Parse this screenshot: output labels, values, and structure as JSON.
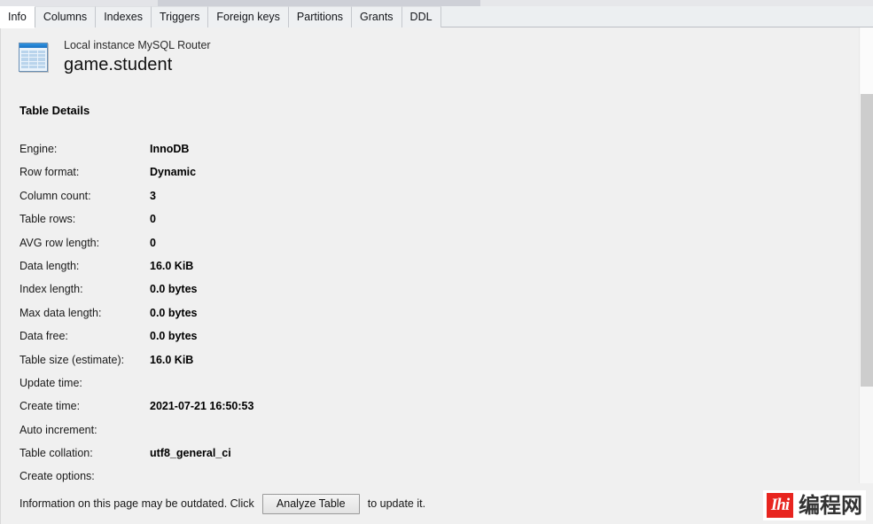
{
  "window": {
    "background_color": "#f0f0f0"
  },
  "tabs": {
    "items": [
      {
        "label": "Info",
        "active": true
      },
      {
        "label": "Columns",
        "active": false
      },
      {
        "label": "Indexes",
        "active": false
      },
      {
        "label": "Triggers",
        "active": false
      },
      {
        "label": "Foreign keys",
        "active": false
      },
      {
        "label": "Partitions",
        "active": false
      },
      {
        "label": "Grants",
        "active": false
      },
      {
        "label": "DDL",
        "active": false
      }
    ]
  },
  "header": {
    "icon": "table-icon",
    "connection": "Local instance MySQL Router",
    "title": "game.student"
  },
  "section": {
    "title": "Table Details"
  },
  "details": {
    "rows": [
      {
        "label": "Engine:",
        "value": "InnoDB"
      },
      {
        "label": "Row format:",
        "value": "Dynamic"
      },
      {
        "label": "Column count:",
        "value": "3"
      },
      {
        "label": "Table rows:",
        "value": "0"
      },
      {
        "label": "AVG row length:",
        "value": "0"
      },
      {
        "label": "Data length:",
        "value": "16.0 KiB"
      },
      {
        "label": "Index length:",
        "value": "0.0 bytes"
      },
      {
        "label": "Max data length:",
        "value": "0.0 bytes"
      },
      {
        "label": "Data free:",
        "value": "0.0 bytes"
      },
      {
        "label": "Table size (estimate):",
        "value": "16.0 KiB"
      },
      {
        "label": "Update time:",
        "value": ""
      },
      {
        "label": "Create time:",
        "value": "2021-07-21 16:50:53"
      },
      {
        "label": "Auto increment:",
        "value": ""
      },
      {
        "label": "Table collation:",
        "value": "utf8_general_ci"
      },
      {
        "label": "Create options:",
        "value": ""
      }
    ]
  },
  "footer": {
    "text_before": "Information on this page may be outdated. Click",
    "button_label": "Analyze Table",
    "text_after": "to update it."
  },
  "scrollbar": {
    "orientation": "vertical"
  },
  "watermark": {
    "mark": "Ihi",
    "text": "编程网"
  }
}
